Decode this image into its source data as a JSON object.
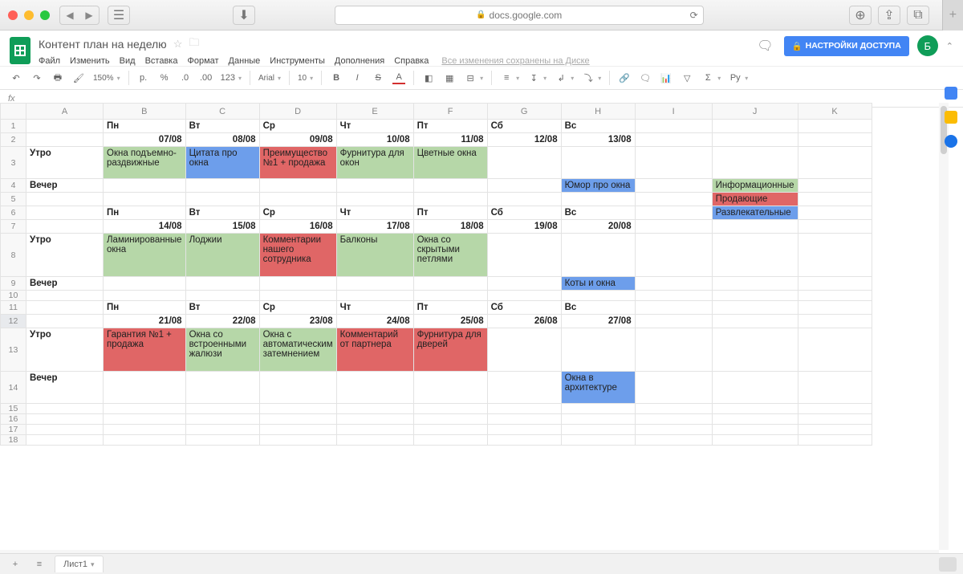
{
  "browser": {
    "url": "docs.google.com"
  },
  "doc": {
    "title": "Контент план на неделю",
    "menus": [
      "Файл",
      "Изменить",
      "Вид",
      "Вставка",
      "Формат",
      "Данные",
      "Инструменты",
      "Дополнения",
      "Справка"
    ],
    "saved": "Все изменения сохранены на Диске",
    "share": "НАСТРОЙКИ ДОСТУПА",
    "avatar": "Б"
  },
  "toolbar": {
    "zoom": "150%",
    "font": "Arial",
    "size": "10",
    "pen": "Ру"
  },
  "sheet": {
    "columns": [
      "A",
      "B",
      "C",
      "D",
      "E",
      "F",
      "G",
      "H",
      "I",
      "J",
      "K"
    ],
    "rows": [
      "1",
      "2",
      "3",
      "4",
      "5",
      "6",
      "7",
      "8",
      "9",
      "10",
      "11",
      "12",
      "13",
      "14",
      "15",
      "16",
      "17",
      "18"
    ],
    "tab": "Лист1",
    "days": [
      "Пн",
      "Вт",
      "Ср",
      "Чт",
      "Пт",
      "Сб",
      "Вс"
    ],
    "labels": {
      "morning": "Утро",
      "evening": "Вечер"
    },
    "legend": {
      "info": "Информационные",
      "sell": "Продающие",
      "fun": "Развлекательные"
    },
    "week1": {
      "dates": [
        "07/08",
        "08/08",
        "09/08",
        "10/08",
        "11/08",
        "12/08",
        "13/08"
      ],
      "morning": {
        "B": {
          "t": "Окна подъемно-раздвижные",
          "c": "green"
        },
        "C": {
          "t": "Цитата про окна",
          "c": "blue"
        },
        "D": {
          "t": "Преимущество №1 + продажа",
          "c": "red"
        },
        "E": {
          "t": "Фурнитура для окон",
          "c": "green"
        },
        "F": {
          "t": "Цветные окна",
          "c": "green"
        }
      },
      "evening": {
        "H": {
          "t": "Юмор про окна",
          "c": "blue"
        }
      }
    },
    "week2": {
      "dates": [
        "14/08",
        "15/08",
        "16/08",
        "17/08",
        "18/08",
        "19/08",
        "20/08"
      ],
      "morning": {
        "B": {
          "t": "Ламинированные окна",
          "c": "green"
        },
        "C": {
          "t": "Лоджии",
          "c": "green"
        },
        "D": {
          "t": "Комментарии нашего сотрудника",
          "c": "red"
        },
        "E": {
          "t": "Балконы",
          "c": "green"
        },
        "F": {
          "t": "Окна со скрытыми петлями",
          "c": "green"
        }
      },
      "evening": {
        "H": {
          "t": "Коты и окна",
          "c": "blue"
        }
      }
    },
    "week3": {
      "dates": [
        "21/08",
        "22/08",
        "23/08",
        "24/08",
        "25/08",
        "26/08",
        "27/08"
      ],
      "morning": {
        "B": {
          "t": "Гарантия №1 + продажа",
          "c": "red"
        },
        "C": {
          "t": "Окна со встроенными жалюзи",
          "c": "green"
        },
        "D": {
          "t": "Окна с автоматическим затемнением",
          "c": "green"
        },
        "E": {
          "t": "Комментарий от партнера",
          "c": "red"
        },
        "F": {
          "t": "Фурнитура для дверей",
          "c": "red"
        }
      },
      "evening": {
        "H": {
          "t": "Окна в архитектуре",
          "c": "blue"
        }
      }
    }
  }
}
